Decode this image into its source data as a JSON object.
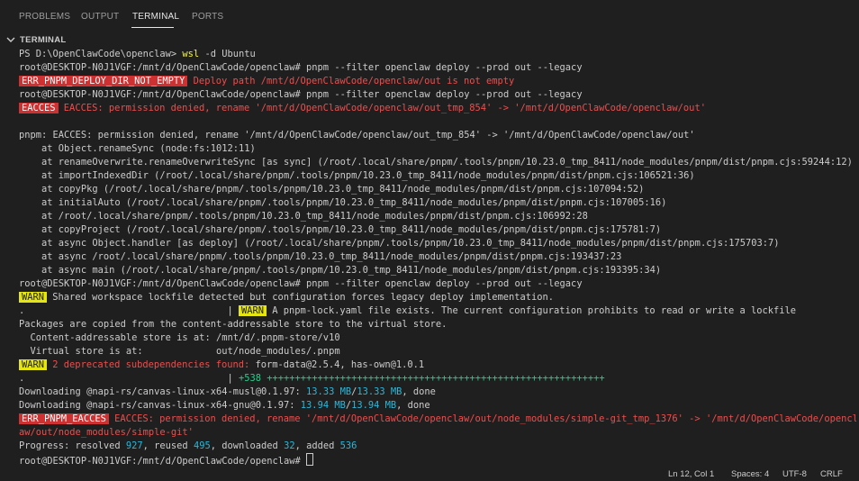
{
  "tabs": [
    "PROBLEMS",
    "OUTPUT",
    "TERMINAL",
    "PORTS"
  ],
  "section_title": "TERMINAL",
  "lines": [
    [
      {
        "t": "PS D:\\OpenClawCode\\openclaw> "
      },
      {
        "t": "wsl",
        "c": "yel"
      },
      {
        "t": " -d Ubuntu"
      }
    ],
    [
      {
        "t": "root@DESKTOP-N0J1VGF:/mnt/d/OpenClawCode/openclaw# pnpm --filter openclaw deploy --prod out --legacy"
      }
    ],
    [
      {
        "t": "ERR_PNPM_DEPLOY_DIR_NOT_EMPTY",
        "c": "bad"
      },
      {
        "t": " Deploy path /mnt/d/OpenClawCode/openclaw/out is not empty",
        "c": "red"
      }
    ],
    [
      {
        "t": "root@DESKTOP-N0J1VGF:/mnt/d/OpenClawCode/openclaw# pnpm --filter openclaw deploy --prod out --legacy"
      }
    ],
    [
      {
        "t": "EACCES",
        "c": "bad"
      },
      {
        "t": " EACCES: permission denied, rename '/mnt/d/OpenClawCode/openclaw/out_tmp_854' -> '/mnt/d/OpenClawCode/openclaw/out'",
        "c": "red"
      }
    ],
    [
      {
        "t": ""
      }
    ],
    [
      {
        "t": "pnpm: EACCES: permission denied, rename '/mnt/d/OpenClawCode/openclaw/out_tmp_854' -> '/mnt/d/OpenClawCode/openclaw/out'"
      }
    ],
    [
      {
        "t": "    at Object.renameSync (node:fs:1012:11)"
      }
    ],
    [
      {
        "t": "    at renameOverwrite.renameOverwriteSync [as sync] (/root/.local/share/pnpm/.tools/pnpm/10.23.0_tmp_8411/node_modules/pnpm/dist/pnpm.cjs:59244:12)"
      }
    ],
    [
      {
        "t": "    at importIndexedDir (/root/.local/share/pnpm/.tools/pnpm/10.23.0_tmp_8411/node_modules/pnpm/dist/pnpm.cjs:106521:36)"
      }
    ],
    [
      {
        "t": "    at copyPkg (/root/.local/share/pnpm/.tools/pnpm/10.23.0_tmp_8411/node_modules/pnpm/dist/pnpm.cjs:107094:52)"
      }
    ],
    [
      {
        "t": "    at initialAuto (/root/.local/share/pnpm/.tools/pnpm/10.23.0_tmp_8411/node_modules/pnpm/dist/pnpm.cjs:107005:16)"
      }
    ],
    [
      {
        "t": "    at /root/.local/share/pnpm/.tools/pnpm/10.23.0_tmp_8411/node_modules/pnpm/dist/pnpm.cjs:106992:28"
      }
    ],
    [
      {
        "t": "    at copyProject (/root/.local/share/pnpm/.tools/pnpm/10.23.0_tmp_8411/node_modules/pnpm/dist/pnpm.cjs:175781:7)"
      }
    ],
    [
      {
        "t": "    at async Object.handler [as deploy] (/root/.local/share/pnpm/.tools/pnpm/10.23.0_tmp_8411/node_modules/pnpm/dist/pnpm.cjs:175703:7)"
      }
    ],
    [
      {
        "t": "    at async /root/.local/share/pnpm/.tools/pnpm/10.23.0_tmp_8411/node_modules/pnpm/dist/pnpm.cjs:193437:23"
      }
    ],
    [
      {
        "t": "    at async main (/root/.local/share/pnpm/.tools/pnpm/10.23.0_tmp_8411/node_modules/pnpm/dist/pnpm.cjs:193395:34)"
      }
    ],
    [
      {
        "t": "root@DESKTOP-N0J1VGF:/mnt/d/OpenClawCode/openclaw# pnpm --filter openclaw deploy --prod out --legacy"
      }
    ],
    [
      {
        "t": "WARN",
        "c": "warn"
      },
      {
        "t": " Shared workspace lockfile detected but configuration forces legacy deploy implementation."
      }
    ],
    [
      {
        "t": ".                                    | "
      },
      {
        "t": "WARN",
        "c": "warn"
      },
      {
        "t": " A pnpm-lock.yaml file exists. The current configuration prohibits to read or write a lockfile"
      }
    ],
    [
      {
        "t": "Packages are copied from the content-addressable store to the virtual store."
      }
    ],
    [
      {
        "t": "  Content-addressable store is at: /mnt/d/.pnpm-store/v10"
      }
    ],
    [
      {
        "t": "  Virtual store is at:             out/node_modules/.pnpm"
      }
    ],
    [
      {
        "t": "WARN",
        "c": "warn"
      },
      {
        "t": " 2 deprecated subdependencies found: ",
        "c": "red"
      },
      {
        "t": "form-data@2.5.4, has-own@1.0.1"
      }
    ],
    [
      {
        "t": ".                                    | "
      },
      {
        "t": "+538",
        "c": "green"
      },
      {
        "t": " ++++++++++++++++++++++++++++++++++++++++++++++++++++++++++++",
        "c": "green"
      }
    ],
    [
      {
        "t": "Downloading @napi-rs/canvas-linux-x64-musl@0.1.97: "
      },
      {
        "t": "13.33 MB",
        "c": "cyan"
      },
      {
        "t": "/"
      },
      {
        "t": "13.33 MB",
        "c": "cyan"
      },
      {
        "t": ", done"
      }
    ],
    [
      {
        "t": "Downloading @napi-rs/canvas-linux-x64-gnu@0.1.97: "
      },
      {
        "t": "13.94 MB",
        "c": "cyan"
      },
      {
        "t": "/"
      },
      {
        "t": "13.94 MB",
        "c": "cyan"
      },
      {
        "t": ", done"
      }
    ],
    [
      {
        "t": "ERR_PNPM_EACCES",
        "c": "bad"
      },
      {
        "t": " EACCES: permission denied, rename '/mnt/d/OpenClawCode/openclaw/out/node_modules/simple-git_tmp_1376' -> '/mnt/d/OpenClawCode/opencl",
        "c": "red"
      }
    ],
    [
      {
        "t": "aw/out/node_modules/simple-git'",
        "c": "red"
      }
    ],
    [
      {
        "t": "Progress: resolved "
      },
      {
        "t": "927",
        "c": "cyan"
      },
      {
        "t": ", reused "
      },
      {
        "t": "495",
        "c": "cyan"
      },
      {
        "t": ", downloaded "
      },
      {
        "t": "32",
        "c": "cyan"
      },
      {
        "t": ", added "
      },
      {
        "t": "536",
        "c": "cyan"
      }
    ],
    [
      {
        "t": "root@DESKTOP-N0J1VGF:/mnt/d/OpenClawCode/openclaw# "
      },
      {
        "cursor": true
      }
    ]
  ],
  "status": {
    "position": "Ln 12, Col 1",
    "spaces": "Spaces: 4",
    "encoding": "UTF-8",
    "eol": "CRLF"
  },
  "colors": {
    "background": "#1f1f1f",
    "error_badge": "#cd3131",
    "warn_badge": "#e5e510",
    "error_text": "#f14c4c",
    "cyan": "#29b8db",
    "green": "#23d18b"
  }
}
